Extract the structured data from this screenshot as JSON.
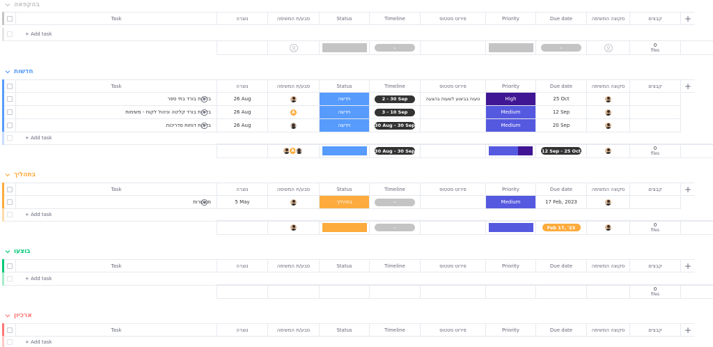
{
  "columns": {
    "task": "Task",
    "created": "נוצרה",
    "owner": "סבע/ת המשימה",
    "status": "Status",
    "timeline": "Timeline",
    "status_detail": "פירוט סטטוס",
    "priority": "Priority",
    "due_date": "Due date",
    "supervisor": "סקוצה המשימה",
    "files": "קבצים",
    "add": "+"
  },
  "add_task_label": "+ Add task",
  "files_label": "files",
  "groups": [
    {
      "title": "בהקפאה",
      "color": "#c4c4c4",
      "rows": [],
      "summary": {
        "timeline": "-",
        "due": "-",
        "files_count": "0"
      }
    },
    {
      "title": "חדשות",
      "color": "#579bfc",
      "rows": [
        {
          "task": "בדיקת בורד בתי ספר",
          "created": "26 Aug",
          "status": "חדשה",
          "timeline": "2 - 30 Sep",
          "status_detail": "טעות בביצוע לשעות בהצעה",
          "priority": "High",
          "due": "25 Oct"
        },
        {
          "task": "בדיקת בורד קליטה וניהול לקוח - משימות",
          "created": "26 Aug",
          "status": "חדשה",
          "timeline": "3 - 10 Sep",
          "status_detail": "",
          "priority": "Medium",
          "due": "12 Sep"
        },
        {
          "task": "בדיקת דוחות סדריכות",
          "created": "26 Aug",
          "status": "חדשה",
          "timeline": "30 Aug - 30 Sep",
          "status_detail": "",
          "priority": "Medium",
          "due": "20 Sep"
        }
      ],
      "summary": {
        "timeline": "30 Aug - 30 Sep",
        "due": "12 Sep - 25 Oct",
        "files_count": "0"
      }
    },
    {
      "title": "בתהליך",
      "color": "#fdab3d",
      "rows": [
        {
          "task": "משכורות",
          "created": "5 May",
          "status": "בתהליך",
          "timeline": "-",
          "status_detail": "",
          "priority": "Medium",
          "due": "17 Feb, 2023"
        }
      ],
      "summary": {
        "timeline": "-",
        "due": "Feb 17, '23",
        "files_count": "0"
      }
    },
    {
      "title": "בוצעו",
      "color": "#00c875",
      "rows": [],
      "summary": {
        "files_count": "0"
      }
    },
    {
      "title": "ארכיון",
      "color": "#ff7575",
      "rows": []
    }
  ],
  "colors": {
    "status_new": "#579bfc",
    "status_progress": "#fdab3d",
    "priority_high": "#401694",
    "priority_medium": "#5559df",
    "empty_grey": "#c4c4c4",
    "timeline_dark": "#333333"
  },
  "icons": {
    "collapse": "chevron-down-icon",
    "add_column": "plus-icon",
    "updates": "add-update-icon",
    "empty_person": "person-placeholder-icon"
  }
}
